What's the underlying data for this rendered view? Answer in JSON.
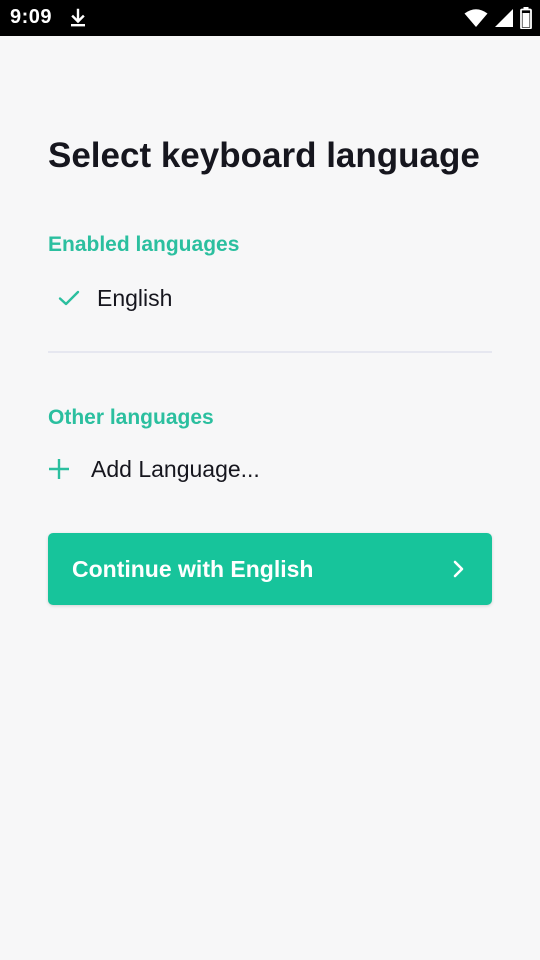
{
  "status_bar": {
    "time": "9:09",
    "icons": [
      "download-icon",
      "wifi-icon",
      "signal-icon",
      "battery-icon"
    ]
  },
  "page": {
    "title": "Select keyboard language"
  },
  "enabled_section": {
    "heading": "Enabled languages",
    "items": [
      {
        "label": "English",
        "icon": "check-icon",
        "checked": true
      }
    ]
  },
  "other_section": {
    "heading": "Other languages",
    "add_label": "Add Language...",
    "icon": "plus-icon"
  },
  "continue_button": {
    "label": "Continue with English",
    "icon": "chevron-right-icon"
  },
  "colors": {
    "accent": "#2bbf9f",
    "button": "#17c49b",
    "text": "#16161e",
    "background": "#f7f7f8",
    "divider": "#e6e7f0"
  }
}
